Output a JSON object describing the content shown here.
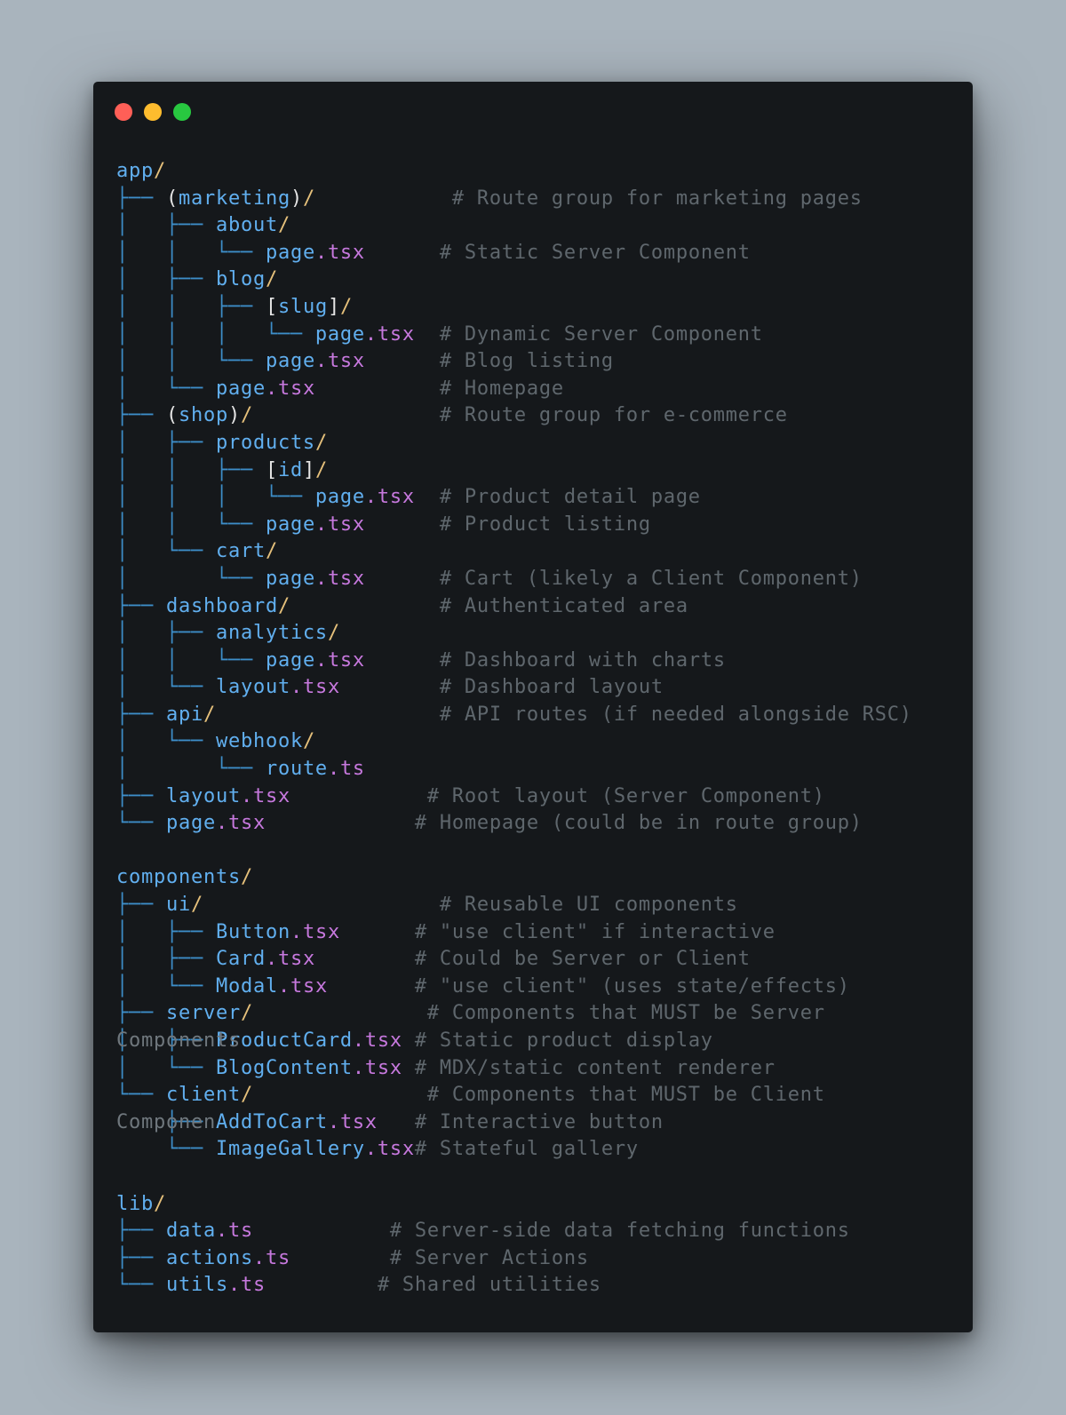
{
  "theme": {
    "page_bg": "#a9b4bd",
    "window_bg": "#15181b",
    "dot_close": "#ff5f57",
    "dot_minimize": "#febc2e",
    "dot_maximize": "#28c840",
    "tree_color": "#3d8ec9",
    "name_color": "#61afef",
    "paren_color": "#e5e5e5",
    "slash_color": "#e5c07b",
    "bracket_color": "#e5e5e5",
    "dot_color": "#c678dd",
    "ext_color": "#c678dd",
    "comment_color": "#5f676d"
  },
  "lines": [
    {
      "tree": "",
      "name": "app",
      "suffix": "/",
      "pad": "",
      "comment": ""
    },
    {
      "tree": "├── ",
      "name": "(marketing)",
      "suffix": "/",
      "pad": "           ",
      "comment": "# Route group for marketing pages"
    },
    {
      "tree": "│   ├── ",
      "name": "about",
      "suffix": "/",
      "pad": "",
      "comment": ""
    },
    {
      "tree": "│   │   └── ",
      "name": "page",
      "suffix": ".tsx",
      "pad": "      ",
      "comment": "# Static Server Component"
    },
    {
      "tree": "│   ├── ",
      "name": "blog",
      "suffix": "/",
      "pad": "",
      "comment": ""
    },
    {
      "tree": "│   │   ├── ",
      "name": "[slug]",
      "suffix": "/",
      "pad": "",
      "comment": ""
    },
    {
      "tree": "│   │   │   └── ",
      "name": "page",
      "suffix": ".tsx",
      "pad": "  ",
      "comment": "# Dynamic Server Component"
    },
    {
      "tree": "│   │   └── ",
      "name": "page",
      "suffix": ".tsx",
      "pad": "      ",
      "comment": "# Blog listing"
    },
    {
      "tree": "│   └── ",
      "name": "page",
      "suffix": ".tsx",
      "pad": "          ",
      "comment": "# Homepage"
    },
    {
      "tree": "├── ",
      "name": "(shop)",
      "suffix": "/",
      "pad": "               ",
      "comment": "# Route group for e-commerce"
    },
    {
      "tree": "│   ├── ",
      "name": "products",
      "suffix": "/",
      "pad": "",
      "comment": ""
    },
    {
      "tree": "│   │   ├── ",
      "name": "[id]",
      "suffix": "/",
      "pad": "",
      "comment": ""
    },
    {
      "tree": "│   │   │   └── ",
      "name": "page",
      "suffix": ".tsx",
      "pad": "  ",
      "comment": "# Product detail page"
    },
    {
      "tree": "│   │   └── ",
      "name": "page",
      "suffix": ".tsx",
      "pad": "      ",
      "comment": "# Product listing"
    },
    {
      "tree": "│   └── ",
      "name": "cart",
      "suffix": "/",
      "pad": "",
      "comment": ""
    },
    {
      "tree": "│       └── ",
      "name": "page",
      "suffix": ".tsx",
      "pad": "      ",
      "comment": "# Cart (likely a Client Component)"
    },
    {
      "tree": "├── ",
      "name": "dashboard",
      "suffix": "/",
      "pad": "            ",
      "comment": "# Authenticated area"
    },
    {
      "tree": "│   ├── ",
      "name": "analytics",
      "suffix": "/",
      "pad": "",
      "comment": ""
    },
    {
      "tree": "│   │   └── ",
      "name": "page",
      "suffix": ".tsx",
      "pad": "      ",
      "comment": "# Dashboard with charts"
    },
    {
      "tree": "│   └── ",
      "name": "layout",
      "suffix": ".tsx",
      "pad": "        ",
      "comment": "# Dashboard layout"
    },
    {
      "tree": "├── ",
      "name": "api",
      "suffix": "/",
      "pad": "                  ",
      "comment": "# API routes (if needed alongside RSC)"
    },
    {
      "tree": "│   └── ",
      "name": "webhook",
      "suffix": "/",
      "pad": "",
      "comment": ""
    },
    {
      "tree": "│       └── ",
      "name": "route",
      "suffix": ".ts",
      "pad": "",
      "comment": ""
    },
    {
      "tree": "├── ",
      "name": "layout",
      "suffix": ".tsx",
      "pad": "           ",
      "comment": "# Root layout (Server Component)"
    },
    {
      "tree": "└── ",
      "name": "page",
      "suffix": ".tsx",
      "pad": "            ",
      "comment": "# Homepage (could be in route group)"
    },
    {
      "blank": true
    },
    {
      "tree": "",
      "name": "components",
      "suffix": "/",
      "pad": "",
      "comment": ""
    },
    {
      "tree": "├── ",
      "name": "ui",
      "suffix": "/",
      "pad": "                   ",
      "comment": "# Reusable UI components"
    },
    {
      "tree": "│   ├── ",
      "name": "Button",
      "suffix": ".tsx",
      "pad": "      ",
      "comment": "# \"use client\" if interactive"
    },
    {
      "tree": "│   ├── ",
      "name": "Card",
      "suffix": ".tsx",
      "pad": "        ",
      "comment": "# Could be Server or Client"
    },
    {
      "tree": "│   └── ",
      "name": "Modal",
      "suffix": ".tsx",
      "pad": "       ",
      "comment": "# \"use client\" (uses state/effects)"
    },
    {
      "tree": "├── ",
      "name": "server",
      "suffix": "/",
      "pad": "              ",
      "comment": "# Components that MUST be Server"
    },
    {
      "tree": "│   ├── ",
      "name": "ProductCard",
      "suffix": ".tsx",
      "pad": " ",
      "comment": "# Static product display",
      "overlay": "Components"
    },
    {
      "tree": "│   └── ",
      "name": "BlogContent",
      "suffix": ".tsx",
      "pad": " ",
      "comment": "# MDX/static content renderer"
    },
    {
      "tree": "└── ",
      "name": "client",
      "suffix": "/",
      "pad": "              ",
      "comment": "# Components that MUST be Client"
    },
    {
      "tree": "    ├── ",
      "name": "AddToCart",
      "suffix": ".tsx",
      "pad": "   ",
      "comment": "# Interactive button",
      "overlay": "Componen"
    },
    {
      "tree": "    └── ",
      "name": "ImageGallery",
      "suffix": ".tsx",
      "pad": "",
      "comment": "# Stateful gallery"
    },
    {
      "blank": true
    },
    {
      "tree": "",
      "name": "lib",
      "suffix": "/",
      "pad": "",
      "comment": ""
    },
    {
      "tree": "├── ",
      "name": "data",
      "suffix": ".ts",
      "pad": "           ",
      "comment": "# Server-side data fetching functions"
    },
    {
      "tree": "├── ",
      "name": "actions",
      "suffix": ".ts",
      "pad": "        ",
      "comment": "# Server Actions"
    },
    {
      "tree": "└── ",
      "name": "utils",
      "suffix": ".ts",
      "pad": "         ",
      "comment": "# Shared utilities"
    }
  ]
}
